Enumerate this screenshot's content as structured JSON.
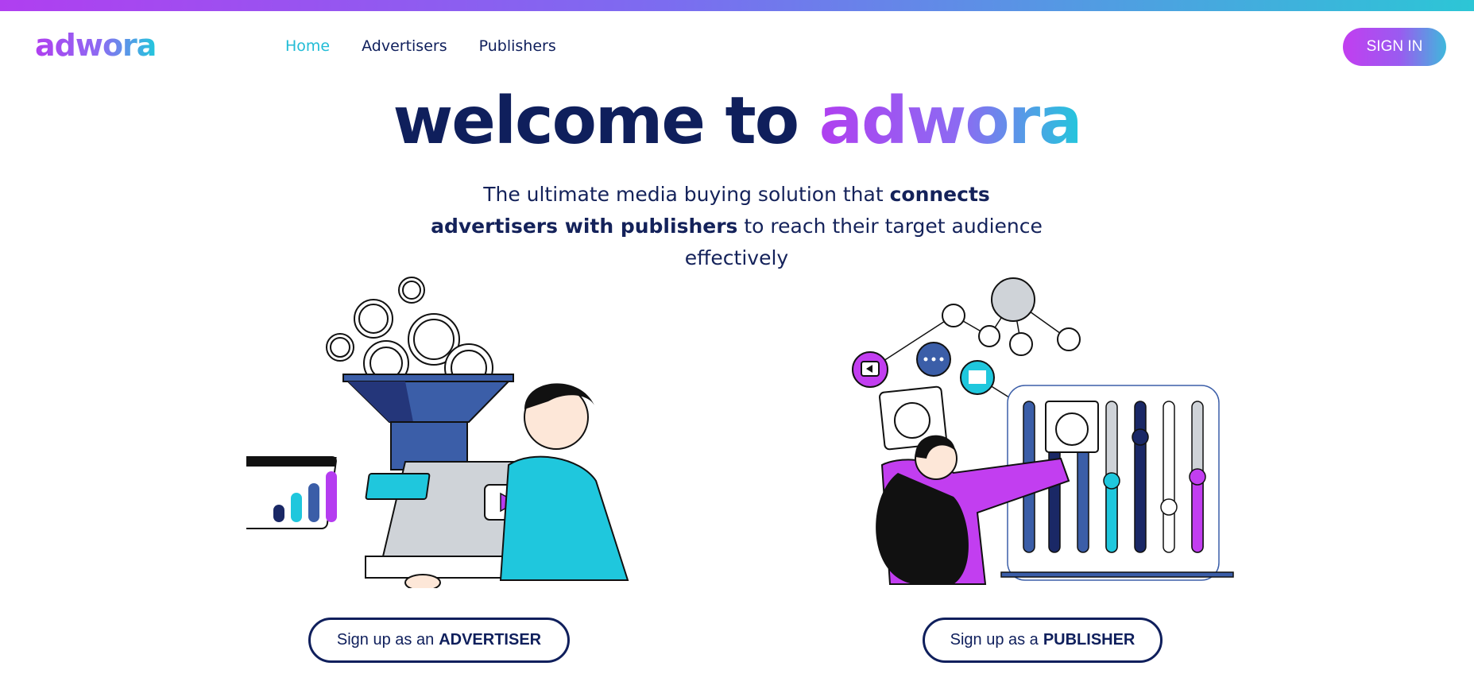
{
  "brand": {
    "name": "adwora",
    "accent_start": "#b03ff0",
    "accent_end": "#22c7dc",
    "navy": "#0f1f5c"
  },
  "nav": {
    "items": [
      {
        "label": "Home",
        "active": true
      },
      {
        "label": "Advertisers",
        "active": false
      },
      {
        "label": "Publishers",
        "active": false
      }
    ],
    "signin_label": "SIGN IN"
  },
  "hero": {
    "title_prefix": "welcome to",
    "title_brand": "adwora",
    "tagline_part1": "The ultimate media buying solution that ",
    "tagline_bold1": "connects advertisers with publishers",
    "tagline_part2": " to reach their target audience effectively"
  },
  "cta": {
    "advertiser_prefix": "Sign up as an",
    "advertiser_bold": "ADVERTISER",
    "publisher_prefix": "Sign up as a",
    "publisher_bold": "PUBLISHER"
  },
  "illustrations": {
    "advertiser": "advertiser-funnel-laptop-illustration",
    "publisher": "publisher-network-sliders-illustration"
  }
}
